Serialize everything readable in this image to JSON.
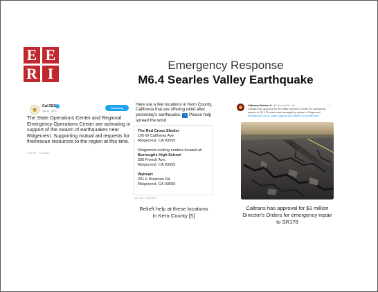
{
  "logo": {
    "row1": [
      "E",
      "E"
    ],
    "row2": [
      "R",
      "I"
    ]
  },
  "title": {
    "line1": "Emergency Response",
    "line2": "M6.4 Searles Valley Earthquake"
  },
  "tweet1": {
    "name": "Cal OES",
    "check": "✓",
    "handle": "@Cal_OES",
    "follow_label": "Following",
    "body": "The State Operations Center and Regional Emergency Operations Center are activating in support of the swarm of earthquakes near Ridgecrest. Supporting mutual aid requests for fire/rescue resources to the region at this time.",
    "time": "1:20 PM · 4 Jul 2019"
  },
  "tweet2": {
    "intro_before": "Here are a few locations in Kern County, California that are offering relief after yesterday's earthquake.",
    "info_glyph": "i",
    "intro_after": "Please help spread the word.",
    "shelter_name": "The Red Cross Shelter",
    "shelter_addr1": "100 W California Ave",
    "shelter_addr2": "Ridgecrest, CA 93555",
    "cooling_intro": "Ridgecrest cooling centers located at:",
    "school_name": "Burroughs High School",
    "school_addr1": "500 French Ave,",
    "school_addr2": "Ridgecrest, CA 93555",
    "store_name": "Walmart",
    "store_addr1": "201 E Bowman Rd",
    "store_addr2": "Ridgecrest, CA 93555",
    "time": "9:03 AM · 5 Jul 2019",
    "caption": "Relieft help at these locations in Kern County [5]"
  },
  "tweet3": {
    "name": "Caltrans District 8",
    "handle": "@CaltransD8 · 6h",
    "chevron": "⌄",
    "body": "Caltrans has approval for $3 million Director's Order for emergency repairs to SR 178 which was damaged by quake in Ridgecrest",
    "links": "#CaltransD8 @CA_State_Agency @CaltransHQ @Caltrans9",
    "caption": "Caltrans has approval for $3 million Director's Orders for emergency repair to SR178"
  },
  "colors": {
    "logo_red": "#c0282d",
    "twitter_blue": "#1da1f2",
    "info_blue": "#1a73c9"
  }
}
